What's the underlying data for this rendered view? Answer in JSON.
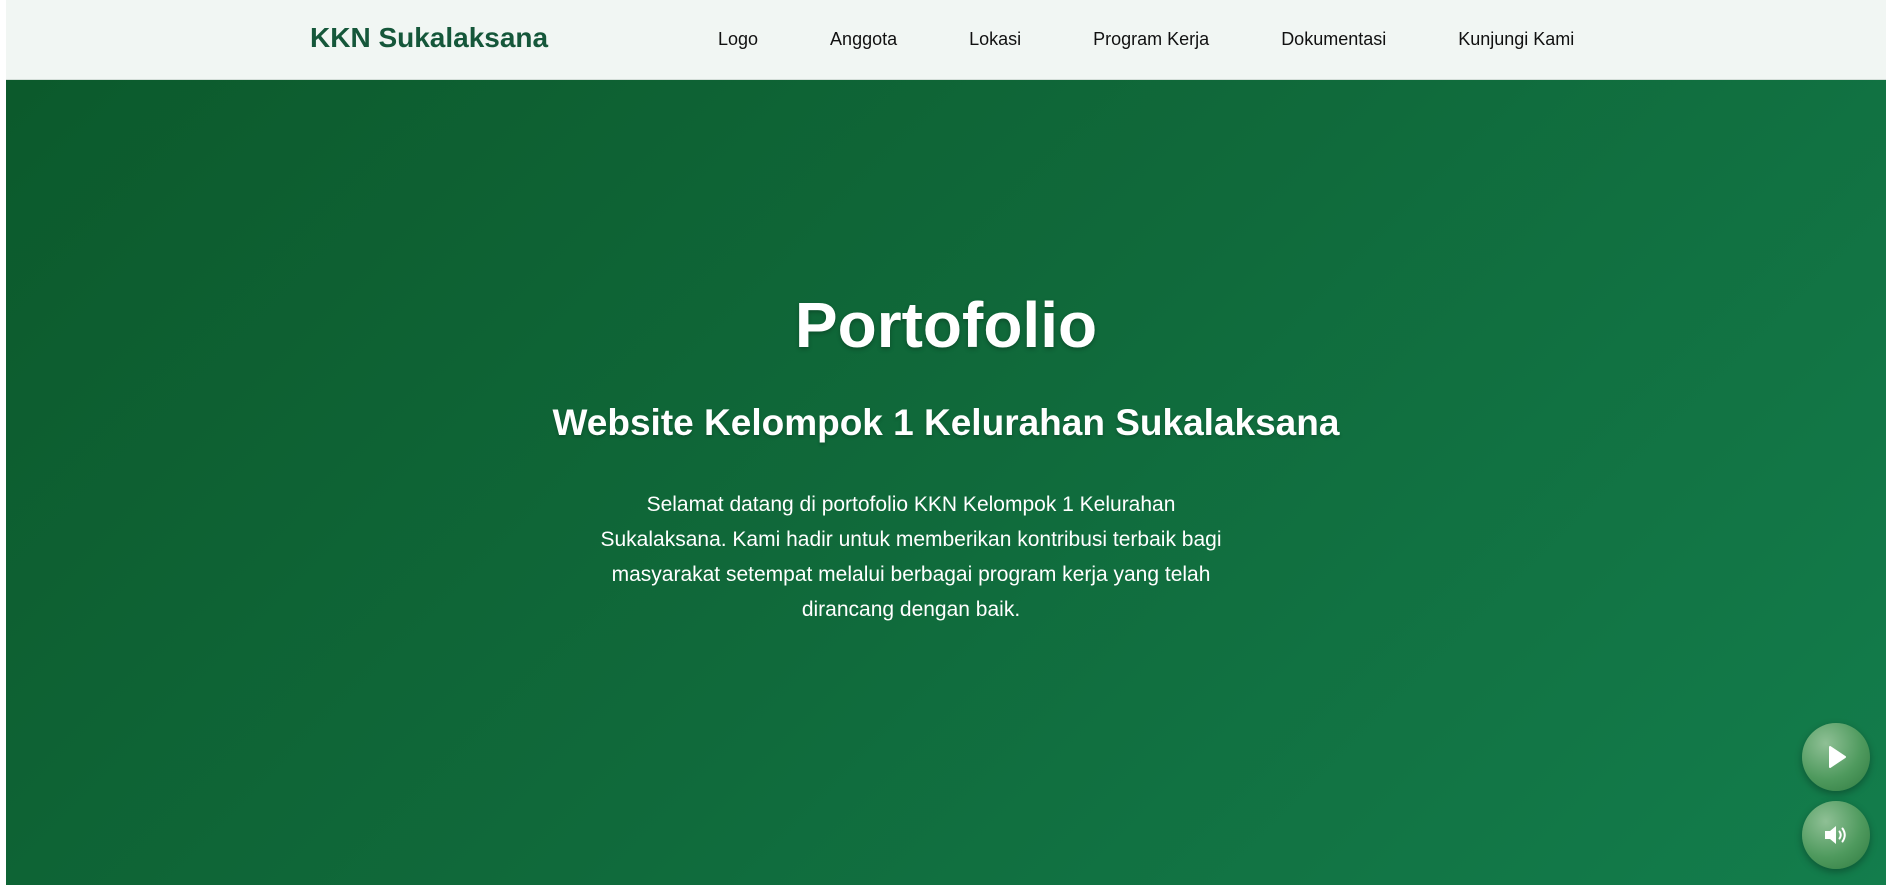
{
  "navbar": {
    "brand": "KKN Sukalaksana",
    "links": [
      {
        "label": "Logo"
      },
      {
        "label": "Anggota"
      },
      {
        "label": "Lokasi"
      },
      {
        "label": "Program Kerja"
      },
      {
        "label": "Dokumentasi"
      },
      {
        "label": "Kunjungi Kami"
      }
    ]
  },
  "hero": {
    "title": "Portofolio",
    "subtitle": "Website Kelompok 1 Kelurahan Sukalaksana",
    "description": "Selamat datang di portofolio KKN Kelompok 1 Kelurahan Sukalaksana. Kami hadir untuk memberikan kontribusi terbaik bagi masyarakat setempat melalui berbagai program kerja yang telah dirancang dengan baik."
  },
  "controls": {
    "play_icon": "play-icon",
    "volume_icon": "volume-icon"
  },
  "colors": {
    "brand": "#15573a",
    "hero_gradient_start": "#0c5a2c",
    "hero_gradient_end": "#137d4c",
    "navbar_bg": "#f1f6f3"
  }
}
